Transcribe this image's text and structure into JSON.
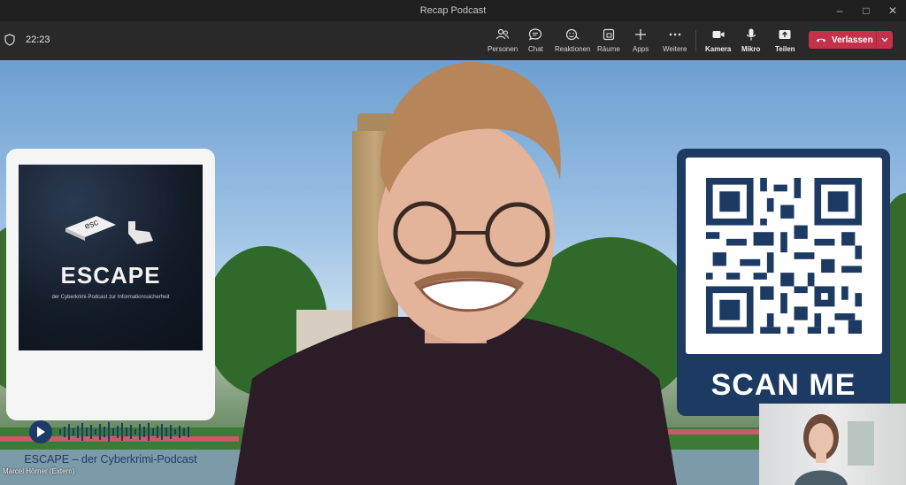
{
  "window": {
    "title": "Recap Podcast",
    "controls": [
      "minimize",
      "maximize",
      "close"
    ]
  },
  "toolbar": {
    "time": "22:23",
    "buttons": [
      {
        "label": "Personen",
        "icon": "people-icon"
      },
      {
        "label": "Chat",
        "icon": "chat-icon"
      },
      {
        "label": "Reaktionen",
        "icon": "reactions-icon"
      },
      {
        "label": "Räume",
        "icon": "rooms-icon"
      },
      {
        "label": "Apps",
        "icon": "plus-icon"
      },
      {
        "label": "Weitere",
        "icon": "more-icon"
      },
      {
        "label": "Kamera",
        "icon": "camera-icon"
      },
      {
        "label": "Mikro",
        "icon": "microphone-icon"
      },
      {
        "label": "Teilen",
        "icon": "share-icon"
      }
    ],
    "leave_label": "Verlassen",
    "leave_color": "#c4314b"
  },
  "stage": {
    "participant_name": "Marcel Hörner (Extern)"
  },
  "podcast_card": {
    "cover_brand": "ESCAPE",
    "cover_key_label": "esc",
    "cover_tagline": "der Cyberkrimi-Podcast zur Informationssicherheit",
    "name": "ESCAPE – der Cyberkrimi-Podcast",
    "accent": "#1e3a6b"
  },
  "qr_card": {
    "label": "SCAN ME",
    "color": "#1d3a63"
  }
}
